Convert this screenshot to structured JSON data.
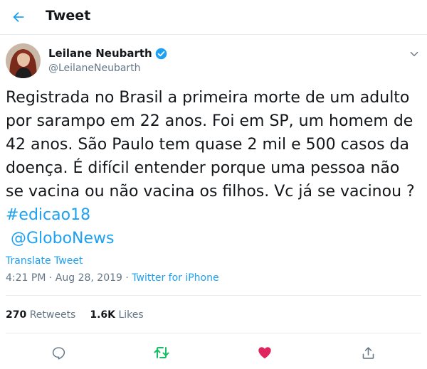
{
  "header": {
    "title": "Tweet"
  },
  "author": {
    "name": "Leilane Neubarth",
    "handle": "@LeilaneNeubarth"
  },
  "tweet": {
    "text": "Registrada no Brasil a primeira morte de um adulto por sarampo em 22 anos. Foi em SP, um homem de 42 anos. São Paulo tem quase 2 mil e 500 casos da doença. É difícil entender porque uma pessoa não se vacina ou não vacina os filhos. Vc já se vacinou ? ",
    "hashtag": "#edicao18",
    "mention": "@GloboNews"
  },
  "translate_label": "Translate Tweet",
  "meta": {
    "time": "4:21 PM",
    "separator": " · ",
    "date": "Aug 28, 2019",
    "source": "Twitter for iPhone"
  },
  "stats": {
    "retweets_count": "270",
    "retweets_label": "Retweets",
    "likes_count": "1.6K",
    "likes_label": "Likes"
  },
  "colors": {
    "accent": "#1da1f2",
    "retweet": "#17bf63",
    "like": "#e0245e",
    "muted": "#657786"
  },
  "icons": [
    "back-arrow-icon",
    "verified-icon",
    "chevron-down-icon",
    "reply-icon",
    "retweet-icon",
    "heart-icon",
    "share-icon"
  ]
}
